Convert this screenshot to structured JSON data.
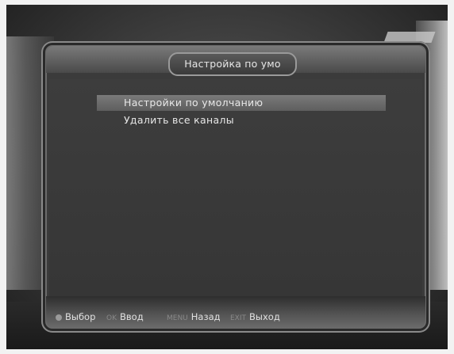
{
  "title": "Настройка по умо",
  "menu": {
    "items": [
      {
        "label": "Настройки по умолчанию",
        "selected": true
      },
      {
        "label": "Удалить все каналы",
        "selected": false
      }
    ]
  },
  "footer": {
    "select_label": "Выбор",
    "ok_key": "OK",
    "enter_label": "Ввод",
    "menu_key": "MENU",
    "back_label": "Назад",
    "exit_key": "EXIT",
    "exit_label": "Выход"
  }
}
